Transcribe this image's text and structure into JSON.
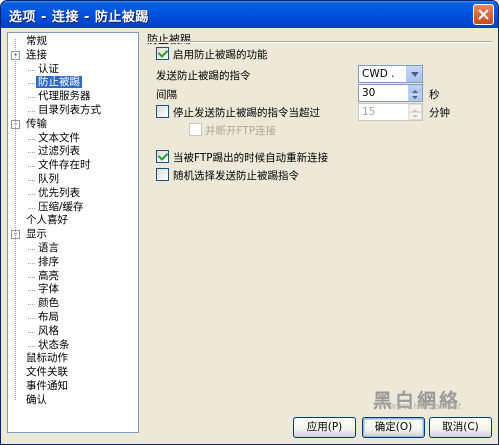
{
  "window": {
    "title": "选项 - 连接 - 防止被踢"
  },
  "tree": [
    {
      "label": "常规",
      "level": 1
    },
    {
      "label": "连接",
      "level": 0,
      "expander": "-"
    },
    {
      "label": "认证",
      "level": 2
    },
    {
      "label": "防止被踢",
      "level": 2,
      "selected": true
    },
    {
      "label": "代理服务器",
      "level": 2
    },
    {
      "label": "目录列表方式",
      "level": 2
    },
    {
      "label": "传输",
      "level": 0,
      "expander": "-"
    },
    {
      "label": "文本文件",
      "level": 2
    },
    {
      "label": "过滤列表",
      "level": 2
    },
    {
      "label": "文件存在时",
      "level": 2
    },
    {
      "label": "队列",
      "level": 2
    },
    {
      "label": "优先列表",
      "level": 2
    },
    {
      "label": "压缩/缓存",
      "level": 2
    },
    {
      "label": "个人喜好",
      "level": 1
    },
    {
      "label": "显示",
      "level": 0,
      "expander": "-"
    },
    {
      "label": "语言",
      "level": 2
    },
    {
      "label": "排序",
      "level": 2
    },
    {
      "label": "高亮",
      "level": 2
    },
    {
      "label": "字体",
      "level": 2
    },
    {
      "label": "颜色",
      "level": 2
    },
    {
      "label": "布局",
      "level": 2
    },
    {
      "label": "风格",
      "level": 2
    },
    {
      "label": "状态条",
      "level": 2
    },
    {
      "label": "鼠标动作",
      "level": 1
    },
    {
      "label": "文件关联",
      "level": 1
    },
    {
      "label": "事件通知",
      "level": 1
    },
    {
      "label": "确认",
      "level": 1
    }
  ],
  "panel": {
    "title": "防止被踢",
    "enable_label": "启用防止被踢的功能",
    "enable_checked": true,
    "command_label": "发送防止被踢的指令",
    "command_value": "CWD .",
    "interval_label": "间隔",
    "interval_value": "30",
    "interval_unit": "秒",
    "stop_label": "停止发送防止被踢的指令当超过",
    "stop_checked": false,
    "stop_value": "15",
    "stop_unit": "分钟",
    "disconnect_label": "并断开FTP连接",
    "disconnect_checked": false,
    "reconnect_label": "当被FTP踢出的时候自动重新连接",
    "reconnect_checked": true,
    "random_label": "随机选择发送防止被踢指令",
    "random_checked": false
  },
  "buttons": {
    "apply": "应用(P)",
    "ok": "确定(O)",
    "cancel": "取消(C)"
  },
  "watermark": {
    "text": "黑白網絡",
    "url": "www.HeiBai.Net"
  }
}
